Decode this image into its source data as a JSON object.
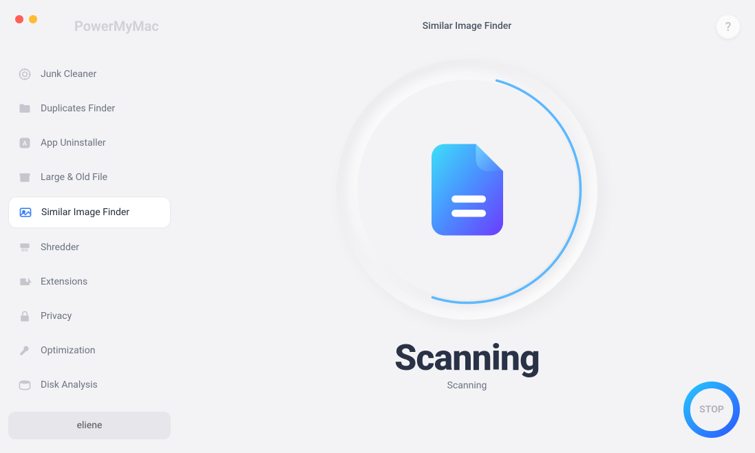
{
  "app": {
    "title": "PowerMyMac"
  },
  "header": {
    "page_title": "Similar Image Finder",
    "help_label": "?"
  },
  "sidebar": {
    "items": [
      {
        "label": "Junk Cleaner",
        "icon": "target-icon"
      },
      {
        "label": "Duplicates Finder",
        "icon": "folder-icon"
      },
      {
        "label": "App Uninstaller",
        "icon": "app-icon"
      },
      {
        "label": "Large & Old File",
        "icon": "box-icon"
      },
      {
        "label": "Similar Image Finder",
        "icon": "image-icon",
        "active": true
      },
      {
        "label": "Shredder",
        "icon": "shredder-icon"
      },
      {
        "label": "Extensions",
        "icon": "puzzle-icon"
      },
      {
        "label": "Privacy",
        "icon": "lock-icon"
      },
      {
        "label": "Optimization",
        "icon": "tools-icon"
      },
      {
        "label": "Disk Analysis",
        "icon": "disk-icon"
      }
    ]
  },
  "user": {
    "name": "eliene"
  },
  "main": {
    "status_title": "Scanning",
    "status_sub": "Scanning",
    "stop_label": "STOP"
  }
}
